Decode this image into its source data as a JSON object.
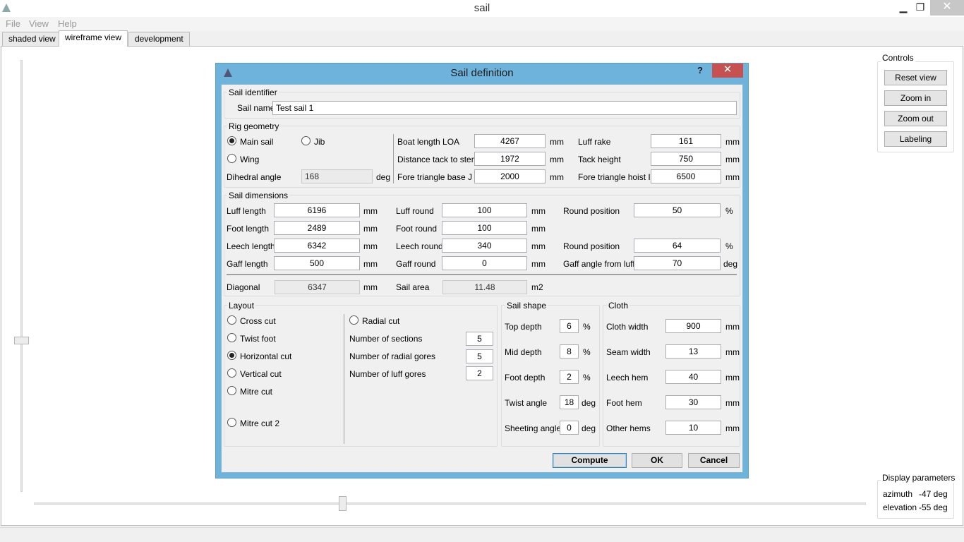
{
  "window": {
    "title": "sail",
    "minimize": "▁",
    "restore": "❐",
    "close": "✕"
  },
  "menu": [
    "File",
    "View",
    "Help"
  ],
  "tabs": [
    "shaded view",
    "wireframe view",
    "development"
  ],
  "controls": {
    "title": "Controls",
    "buttons": [
      "Reset view",
      "Zoom in",
      "Zoom out",
      "Labeling"
    ]
  },
  "display": {
    "title": "Display parameters",
    "azimuth_label": "azimuth",
    "azimuth_value": "-47 deg",
    "elevation_label": "elevation",
    "elevation_value": "-55 deg"
  },
  "dialog": {
    "title": "Sail definition",
    "help": "?",
    "close": "✕",
    "identifier": {
      "group": "Sail identifier",
      "name_label": "Sail name",
      "name_value": "Test sail 1"
    },
    "rig": {
      "group": "Rig geometry",
      "main_sail": "Main sail",
      "jib": "Jib",
      "wing": "Wing",
      "dihedral_label": "Dihedral angle",
      "dihedral_value": "168",
      "dihedral_unit": "deg",
      "boat_length_label": "Boat length LOA",
      "boat_length_value": "4267",
      "boat_length_unit": "mm",
      "tack_stem_label": "Distance tack to stem",
      "tack_stem_value": "1972",
      "tack_stem_unit": "mm",
      "fore_base_label": "Fore triangle base  J",
      "fore_base_value": "2000",
      "fore_base_unit": "mm",
      "luff_rake_label": "Luff rake",
      "luff_rake_value": "161",
      "luff_rake_unit": "mm",
      "tack_height_label": "Tack height",
      "tack_height_value": "750",
      "tack_height_unit": "mm",
      "fore_hoist_label": "Fore triangle hoist  I",
      "fore_hoist_value": "6500",
      "fore_hoist_unit": "mm"
    },
    "dims": {
      "group": "Sail dimensions",
      "luff_length_label": "Luff length",
      "luff_length_value": "6196",
      "foot_length_label": "Foot length",
      "foot_length_value": "2489",
      "leech_length_label": "Leech length",
      "leech_length_value": "6342",
      "gaff_length_label": "Gaff length",
      "gaff_length_value": "500",
      "luff_round_label": "Luff round",
      "luff_round_value": "100",
      "foot_round_label": "Foot round",
      "foot_round_value": "100",
      "leech_round_label": "Leech round",
      "leech_round_value": "340",
      "gaff_round_label": "Gaff round",
      "gaff_round_value": "0",
      "round_pos1_label": "Round position",
      "round_pos1_value": "50",
      "round_pos1_unit": "%",
      "round_pos2_label": "Round position",
      "round_pos2_value": "64",
      "round_pos2_unit": "%",
      "gaff_angle_label": "Gaff angle from luff",
      "gaff_angle_value": "70",
      "gaff_angle_unit": "deg",
      "diagonal_label": "Diagonal",
      "diagonal_value": "6347",
      "diagonal_unit": "mm",
      "area_label": "Sail area",
      "area_value": "11.48",
      "area_unit": "m2",
      "mm": "mm"
    },
    "layout": {
      "group": "Layout",
      "cuts": [
        "Cross cut",
        "Twist foot",
        "Horizontal cut",
        "Vertical cut",
        "Mitre cut",
        "Mitre cut 2"
      ],
      "selected_cut": "Horizontal cut",
      "radial": "Radial cut",
      "sections_label": "Number of sections",
      "sections_value": "5",
      "radial_gores_label": "Number of radial gores",
      "radial_gores_value": "5",
      "luff_gores_label": "Number of luff gores",
      "luff_gores_value": "2"
    },
    "shape": {
      "group": "Sail shape",
      "top_label": "Top depth",
      "top_value": "6",
      "top_unit": "%",
      "mid_label": "Mid depth",
      "mid_value": "8",
      "mid_unit": "%",
      "foot_label": "Foot depth",
      "foot_value": "2",
      "foot_unit": "%",
      "twist_label": "Twist angle",
      "twist_value": "18",
      "twist_unit": "deg",
      "sheeting_label": "Sheeting angle",
      "sheeting_value": "0",
      "sheeting_unit": "deg"
    },
    "cloth": {
      "group": "Cloth",
      "width_label": "Cloth width",
      "width_value": "900",
      "seam_label": "Seam width",
      "seam_value": "13",
      "leech_hem_label": "Leech hem",
      "leech_hem_value": "40",
      "foot_hem_label": "Foot hem",
      "foot_hem_value": "30",
      "other_hems_label": "Other hems",
      "other_hems_value": "10",
      "unit": "mm"
    },
    "buttons": {
      "compute": "Compute",
      "ok": "OK",
      "cancel": "Cancel"
    }
  }
}
